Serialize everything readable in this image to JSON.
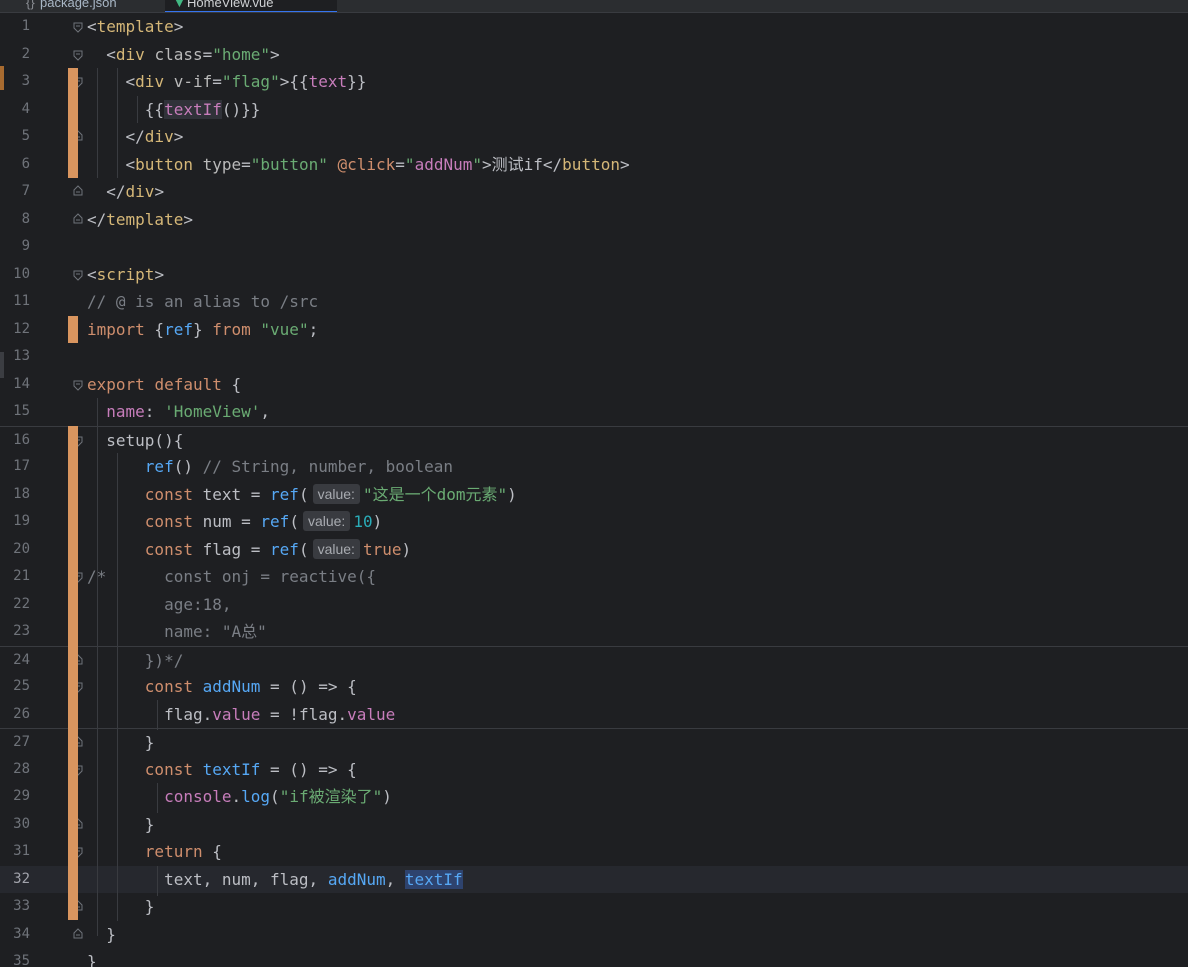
{
  "tabs": [
    {
      "label": "package.json",
      "icon": "json-file-icon"
    },
    {
      "label": "HomeView.vue",
      "icon": "vue-file-icon"
    }
  ],
  "hints": {
    "value": "value:"
  },
  "lines": [
    {
      "n": "1"
    },
    {
      "n": "2"
    },
    {
      "n": "3"
    },
    {
      "n": "4"
    },
    {
      "n": "5"
    },
    {
      "n": "6"
    },
    {
      "n": "7"
    },
    {
      "n": "8"
    },
    {
      "n": "9"
    },
    {
      "n": "10"
    },
    {
      "n": "11"
    },
    {
      "n": "12"
    },
    {
      "n": "13"
    },
    {
      "n": "14"
    },
    {
      "n": "15"
    },
    {
      "n": "16"
    },
    {
      "n": "17"
    },
    {
      "n": "18"
    },
    {
      "n": "19"
    },
    {
      "n": "20"
    },
    {
      "n": "21"
    },
    {
      "n": "22"
    },
    {
      "n": "23"
    },
    {
      "n": "24"
    },
    {
      "n": "25"
    },
    {
      "n": "26"
    },
    {
      "n": "27"
    },
    {
      "n": "28"
    },
    {
      "n": "29"
    },
    {
      "n": "30"
    },
    {
      "n": "31"
    },
    {
      "n": "32"
    },
    {
      "n": "33"
    },
    {
      "n": "34"
    },
    {
      "n": "35"
    }
  ],
  "code": {
    "l1": [
      "<",
      "template",
      ">"
    ],
    "l2": [
      "<",
      "div",
      " class",
      "=",
      "\"home\"",
      ">"
    ],
    "l3": [
      "<",
      "div",
      " v-if",
      "=",
      "\"",
      "flag",
      "\"",
      ">{{",
      "text",
      "}}"
    ],
    "l4": [
      "{{",
      "textIf",
      "()}}"
    ],
    "l5": [
      "</",
      "div",
      ">"
    ],
    "l6": [
      "<",
      "button",
      " type",
      "=",
      "\"button\"",
      " @click",
      "=",
      "\"",
      "addNum",
      "\"",
      ">测试if</",
      "button",
      ">"
    ],
    "l7": [
      "</",
      "div",
      ">"
    ],
    "l8": [
      "</",
      "template",
      ">"
    ],
    "l10": [
      "<",
      "script",
      ">"
    ],
    "l11": [
      "// @ is an alias to /src"
    ],
    "l12": [
      "import",
      " {",
      "ref",
      "} ",
      "from",
      " ",
      "\"vue\"",
      ";"
    ],
    "l14": [
      "export",
      " ",
      "default",
      " {"
    ],
    "l15": [
      "name",
      ": ",
      "'HomeView'",
      ","
    ],
    "l16": [
      "setup(){"
    ],
    "l17": [
      "ref",
      "() ",
      "// String, number, boolean"
    ],
    "l18": [
      "const",
      " text = ",
      "ref",
      "(",
      "\"这是一个dom元素\"",
      ")"
    ],
    "l19": [
      "const",
      " num = ",
      "ref",
      "(",
      "10",
      ")"
    ],
    "l20": [
      "const",
      " flag = ",
      "ref",
      "(",
      "true",
      ")"
    ],
    "l21": [
      "/*",
      "      const onj = reactive({"
    ],
    "l22": [
      "age:18,"
    ],
    "l23": [
      "name: \"A总\""
    ],
    "l24": [
      "})*/"
    ],
    "l25": [
      "const",
      " ",
      "addNum",
      " = () => {"
    ],
    "l26": [
      "flag.",
      "value",
      " = !flag.",
      "value"
    ],
    "l27": [
      "}"
    ],
    "l28": [
      "const",
      " ",
      "textIf",
      " = () => {"
    ],
    "l29": [
      "console",
      ".",
      "log",
      "(",
      "\"if被渲染了\"",
      ")"
    ],
    "l30": [
      "}"
    ],
    "l31": [
      "return",
      " {"
    ],
    "l32": [
      "text, num, flag, ",
      "addNum",
      ", ",
      "textIf"
    ],
    "l33": [
      "}"
    ],
    "l34": [
      "}"
    ],
    "l35": [
      "}"
    ]
  },
  "colors": {
    "background": "#1e1f22",
    "change_marker": "#d9955f",
    "keyword": "#cf8e6d",
    "tag": "#d5b778",
    "string": "#6aab73",
    "comment": "#7a7e85",
    "function": "#56a8f5",
    "property": "#c77dbb",
    "number": "#2aacb8"
  }
}
